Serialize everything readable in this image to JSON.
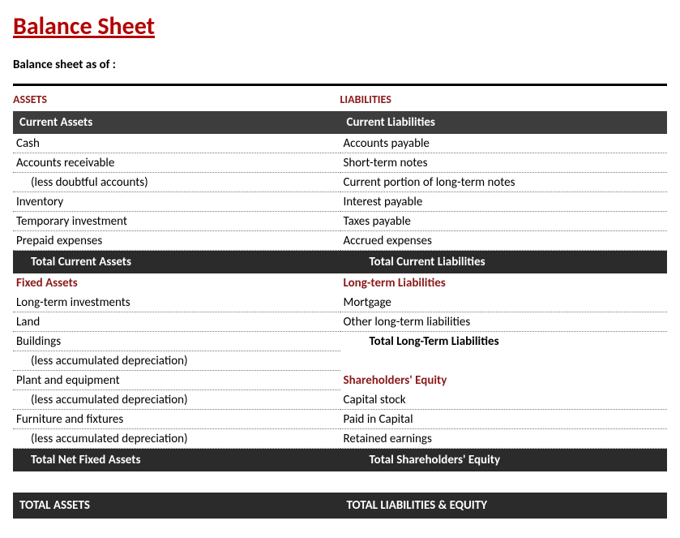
{
  "title": "Balance Sheet",
  "subtitle": "Balance sheet as of :",
  "assets": {
    "label": "ASSETS",
    "current": {
      "header": "Current Assets",
      "items": [
        {
          "label": "Cash",
          "indent": false
        },
        {
          "label": "Accounts receivable",
          "indent": false
        },
        {
          "label": "(less doubtful accounts)",
          "indent": true
        },
        {
          "label": "Inventory",
          "indent": false
        },
        {
          "label": "Temporary investment",
          "indent": false
        },
        {
          "label": "Prepaid expenses",
          "indent": false
        }
      ],
      "total": "Total Current Assets"
    },
    "fixed": {
      "header": "Fixed Assets",
      "items": [
        {
          "label": "Long-term investments",
          "indent": false
        },
        {
          "label": "Land",
          "indent": false
        },
        {
          "label": "Buildings",
          "indent": false
        },
        {
          "label": "(less accumulated depreciation)",
          "indent": true
        },
        {
          "label": "Plant and equipment",
          "indent": false
        },
        {
          "label": "(less accumulated depreciation)",
          "indent": true
        },
        {
          "label": "Furniture and fixtures",
          "indent": false
        },
        {
          "label": "(less accumulated depreciation)",
          "indent": true
        }
      ],
      "total": "Total Net Fixed Assets"
    },
    "grand_total": "TOTAL ASSETS"
  },
  "liabilities": {
    "label": "LIABILITIES",
    "current": {
      "header": "Current Liabilities",
      "items": [
        {
          "label": "Accounts payable"
        },
        {
          "label": "Short-term notes"
        },
        {
          "label": "Current portion of long-term notes"
        },
        {
          "label": "Interest payable"
        },
        {
          "label": "Taxes payable"
        },
        {
          "label": "Accrued expenses"
        }
      ],
      "total": "Total Current Liabilities"
    },
    "longterm": {
      "header": "Long-term Liabilities",
      "items": [
        {
          "label": "Mortgage"
        },
        {
          "label": "Other long-term liabilities"
        }
      ],
      "total": "Total Long-Term Liabilities"
    },
    "equity": {
      "header": "Shareholders' Equity",
      "items": [
        {
          "label": "Capital stock"
        },
        {
          "label": "Paid in Capital"
        },
        {
          "label": "Retained earnings"
        }
      ],
      "total": "Total Shareholders' Equity"
    },
    "grand_total": "TOTAL LIABILITIES & EQUITY"
  }
}
